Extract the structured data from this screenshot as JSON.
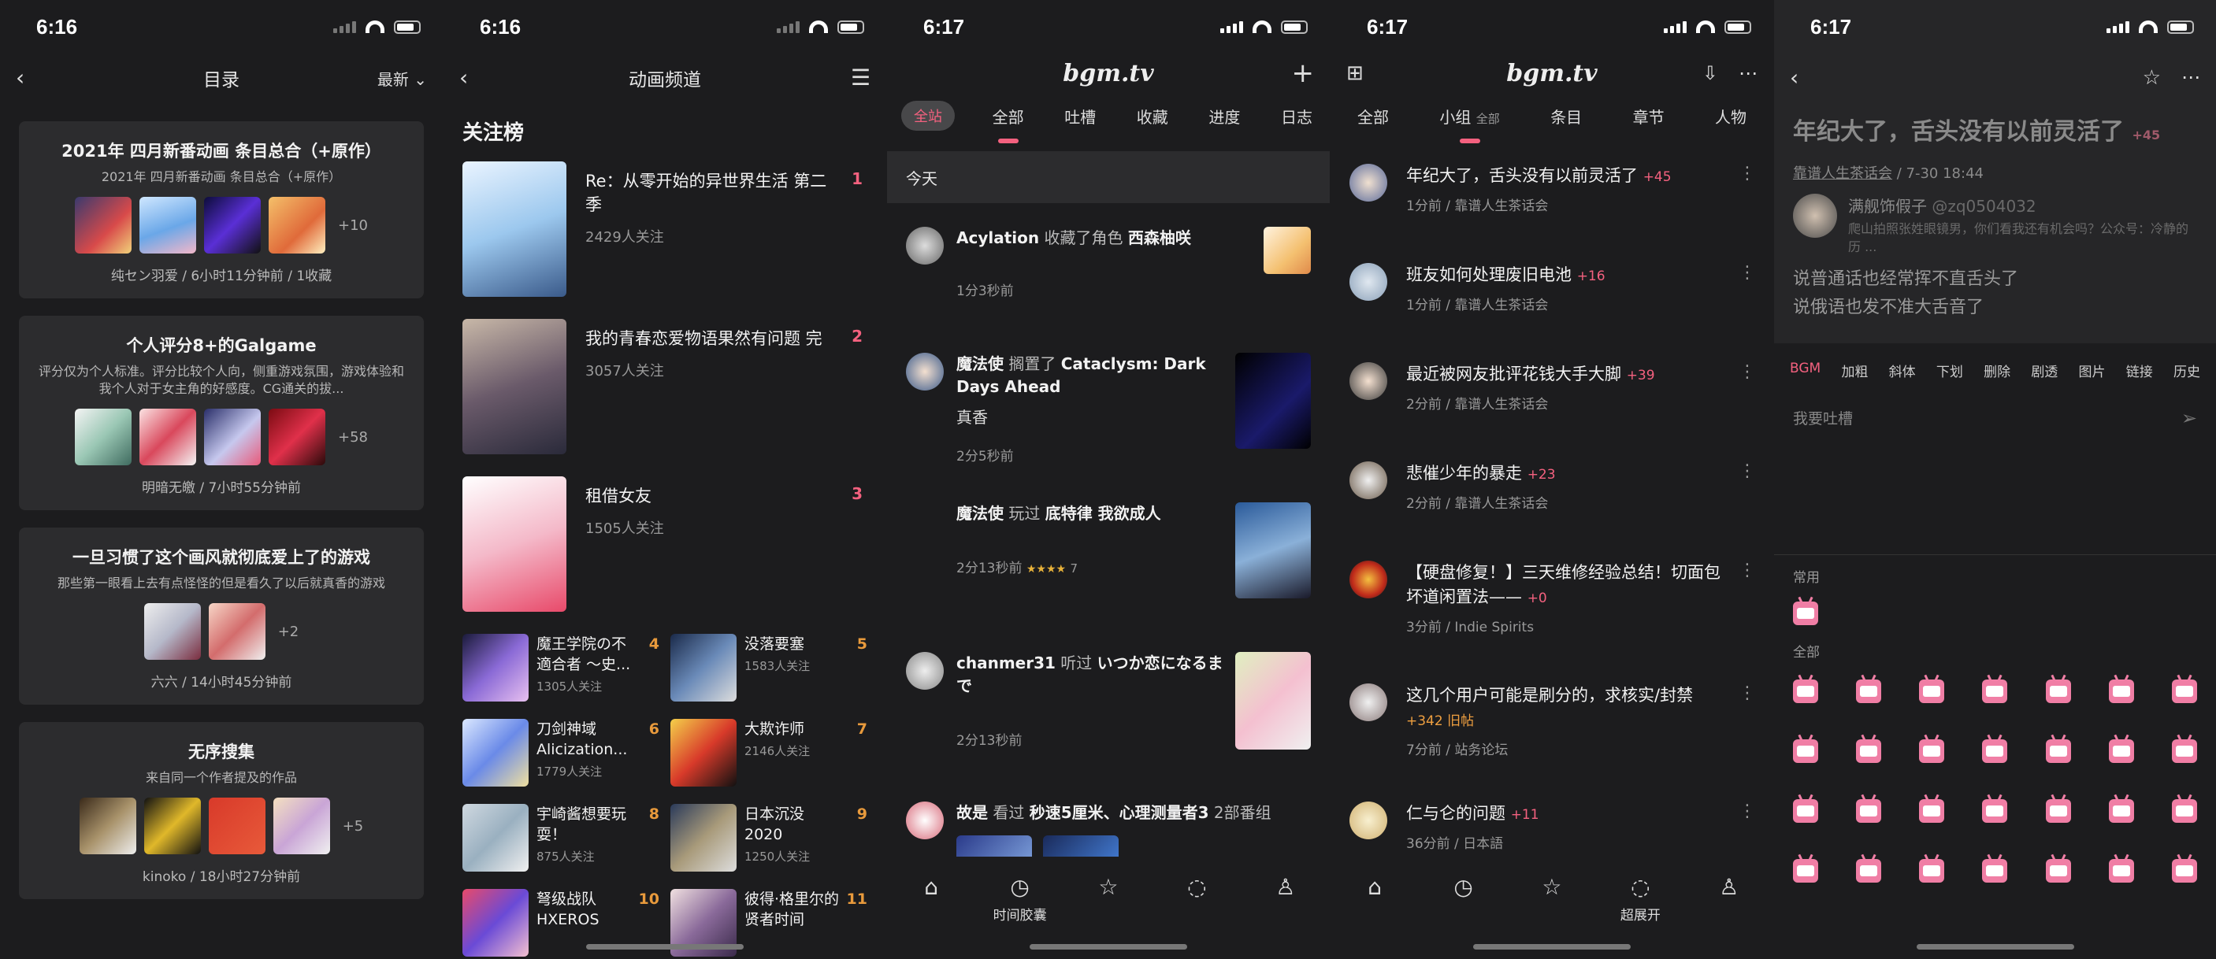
{
  "status": {
    "p1": "6:16",
    "p2": "6:16",
    "p3": "6:17",
    "p4": "6:17",
    "p5": "6:17"
  },
  "phone1": {
    "title": "目录",
    "sort": "最新",
    "cards": [
      {
        "title": "2021年 四月新番动画 条目总合（+原作）",
        "desc": "2021年 四月新番动画 条目总合（+原作）",
        "more": "+10",
        "meta": "纯セン羽爱 / 6小时11分钟前 / 1收藏"
      },
      {
        "title": "个人评分8+的Galgame",
        "desc": "评分仅为个人标准。评分比较个人向，侧重游戏氛围，游戏体验和我个人对于女主角的好感度。CG通关的拔...",
        "more": "+58",
        "meta": "明暗无皦 / 7小时55分钟前"
      },
      {
        "title": "一旦习惯了这个画风就彻底爱上了的游戏",
        "desc": "那些第一眼看上去有点怪怪的但是看久了以后就真香的游戏",
        "more": "+2",
        "meta": "六六 / 14小时45分钟前"
      },
      {
        "title": "无序搜集",
        "desc": "来自同一个作者提及的作品",
        "more": "+5",
        "meta": "kinoko / 18小时27分钟前"
      }
    ]
  },
  "phone2": {
    "title": "动画频道",
    "section": "关注榜",
    "big": [
      {
        "title": "Re：从零开始的异世界生活 第二季",
        "fans": "2429人关注",
        "rank": "1"
      },
      {
        "title": "我的青春恋爱物语果然有问题 完",
        "fans": "3057人关注",
        "rank": "2"
      },
      {
        "title": "租借女友",
        "fans": "1505人关注",
        "rank": "3"
      }
    ],
    "small": [
      {
        "title": "魔王学院の不適合者 ～史...",
        "fans": "1305人关注",
        "rank": "4"
      },
      {
        "title": "没落要塞",
        "fans": "1583人关注",
        "rank": "5"
      },
      {
        "title": "刀剑神域 Alicization...",
        "fans": "1779人关注",
        "rank": "6"
      },
      {
        "title": "大欺诈师",
        "fans": "2146人关注",
        "rank": "7"
      },
      {
        "title": "宇崎酱想要玩耍！",
        "fans": "875人关注",
        "rank": "8"
      },
      {
        "title": "日本沉没 2020",
        "fans": "1250人关注",
        "rank": "9"
      },
      {
        "title": "弩级战队 HXEROS",
        "fans": "",
        "rank": "10"
      },
      {
        "title": "彼得·格里尔的贤者时间",
        "fans": "",
        "rank": "11"
      }
    ]
  },
  "phone3": {
    "logo": "bgm.tv",
    "tabs": [
      "全站",
      "全部",
      "吐槽",
      "收藏",
      "进度",
      "日志"
    ],
    "day": "今天",
    "feed": [
      {
        "user": "Acylation",
        "action": "收藏了角色",
        "target": "西森柚咲",
        "extra": "",
        "time": "1分3秒前"
      },
      {
        "user": "魔法使",
        "action": "搁置了",
        "target": "Cataclysm: Dark Days Ahead",
        "extra": "真香",
        "time": "2分5秒前"
      },
      {
        "user": "魔法使",
        "action": "玩过",
        "target": "底特律 我欲成人",
        "extra": "",
        "time": "2分13秒前",
        "stars": "★★★★",
        "score": "7"
      },
      {
        "user": "chanmer31",
        "action": "听过",
        "target": "いつか恋になるまで",
        "extra": "",
        "time": "2分13秒前"
      },
      {
        "user": "故是",
        "action": "看过",
        "target": "秒速5厘米、心理测量者3",
        "extra": "2部番组",
        "time": ""
      }
    ],
    "bottom": [
      "",
      "时间胶囊",
      "",
      "",
      ""
    ]
  },
  "phone4": {
    "logo": "bgm.tv",
    "tabs": [
      "全部",
      "小组",
      "条目",
      "章节",
      "人物"
    ],
    "tab_sub": "全部",
    "topics": [
      {
        "title": "年纪大了，舌头没有以前灵活了",
        "count": "+45",
        "meta": "1分前 / 靠谱人生茶话会"
      },
      {
        "title": "班友如何处理废旧电池",
        "count": "+16",
        "meta": "1分前 / 靠谱人生茶话会"
      },
      {
        "title": "最近被网友批评花钱大手大脚",
        "count": "+39",
        "meta": "2分前 / 靠谱人生茶话会"
      },
      {
        "title": "悲催少年的暴走",
        "count": "+23",
        "meta": "2分前 / 靠谱人生茶话会"
      },
      {
        "title": "【硬盘修复！】三天维修经验总结！切面包坏道闲置法——",
        "count": "+0",
        "meta": "3分前 / Indie Spirits"
      },
      {
        "title": "这几个用户可能是刷分的，求核实/封禁",
        "count": "+342 旧帖",
        "meta": "7分前 / 站务论坛"
      },
      {
        "title": "仁与仑的问题",
        "count": "+11",
        "meta": "36分前 / 日本語"
      }
    ],
    "bottom": [
      "",
      "",
      "",
      "超展开",
      ""
    ]
  },
  "phone5": {
    "title": "年纪大了，舌头没有以前灵活了",
    "count": "+45",
    "group": "靠谱人生茶话会",
    "date": "/ 7-30 18:44",
    "author": "满舰饰假子",
    "handle": "@zq0504032",
    "sign": "爬山拍照张姓眼镜男，你们看我还有机会吗？公众号：冷静的历 ...",
    "body1": "说普通话也经常挥不直舌头了",
    "body2": "说俄语也发不准大舌音了",
    "toolbar": [
      "BGM",
      "加粗",
      "斜体",
      "下划",
      "删除",
      "剧透",
      "图片",
      "链接",
      "历史"
    ],
    "placeholder": "我要吐槽",
    "common": "常用",
    "all": "全部"
  },
  "colors": {
    "accent": "#f4617f",
    "bg": "#1c1c1e",
    "card": "#2c2c2e"
  }
}
